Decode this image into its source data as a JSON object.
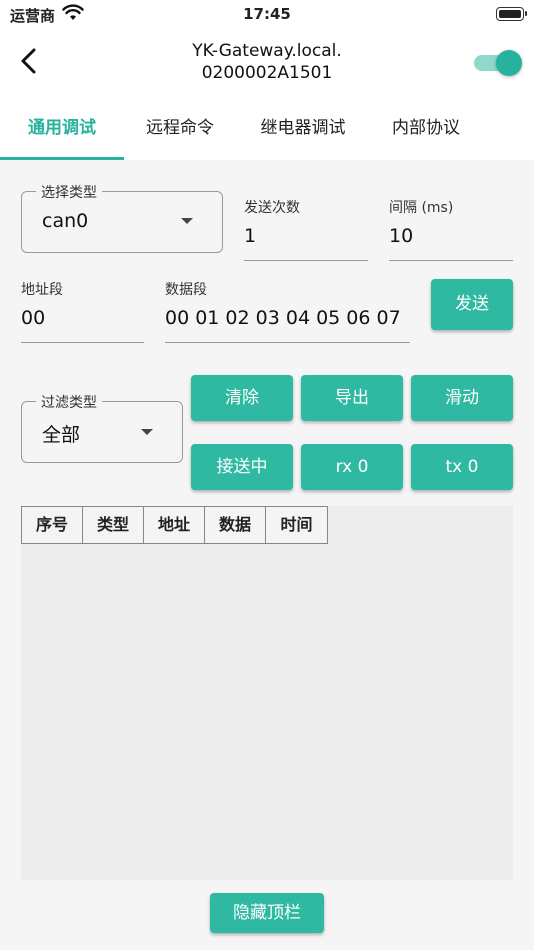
{
  "status_bar": {
    "carrier": "运营商",
    "time": "17:45"
  },
  "header": {
    "title_line1": "YK-Gateway.local.",
    "title_line2": "0200002A1501",
    "toggle_on": true
  },
  "tabs": [
    {
      "label": "通用调试",
      "active": true
    },
    {
      "label": "远程命令",
      "active": false
    },
    {
      "label": "继电器调试",
      "active": false
    },
    {
      "label": "内部协议",
      "active": false
    }
  ],
  "send_config": {
    "type_label": "选择类型",
    "type_value": "can0",
    "count_label": "发送次数",
    "count_value": "1",
    "interval_label": "间隔 (ms)",
    "interval_value": "10",
    "address_label": "地址段",
    "address_value": "00",
    "data_label": "数据段",
    "data_value": "00 01 02 03 04 05 06 07",
    "send_button": "发送"
  },
  "filter": {
    "label": "过滤类型",
    "value": "全部"
  },
  "actions": {
    "clear": "清除",
    "export": "导出",
    "scroll": "滑动",
    "receiving": "接送中",
    "rx": "rx 0",
    "tx": "tx 0"
  },
  "log_table": {
    "columns": [
      "序号",
      "类型",
      "地址",
      "数据",
      "时间"
    ]
  },
  "footer": {
    "hide_topbar": "隐藏顶栏"
  },
  "colors": {
    "accent": "#2fb8a2",
    "tab_active": "#26b29d"
  }
}
